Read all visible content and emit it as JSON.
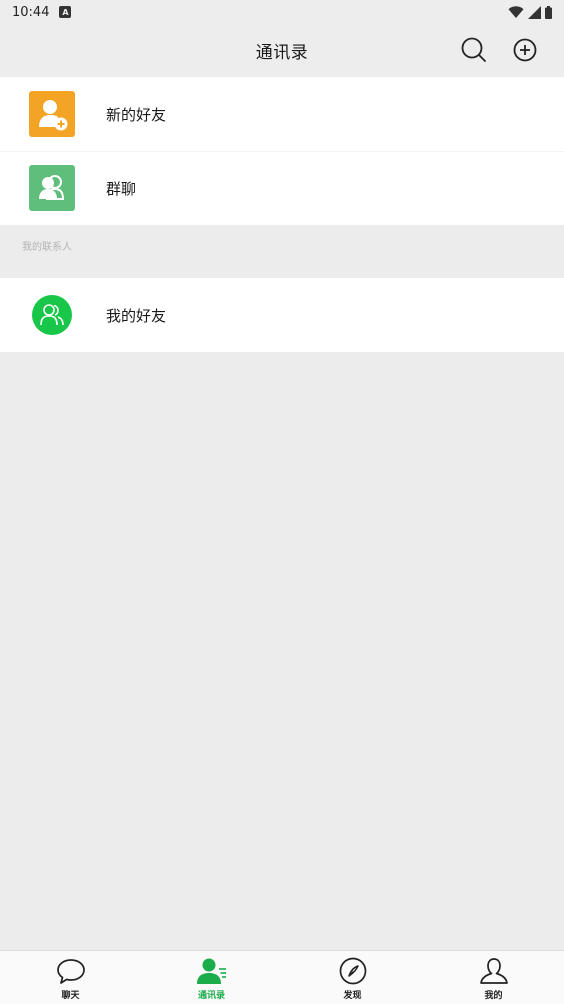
{
  "status_bar": {
    "time": "10:44",
    "indicator": "A"
  },
  "header": {
    "title": "通讯录"
  },
  "top_items": [
    {
      "label": "新的好友",
      "icon": "add-friend-icon",
      "color": "#f4a425"
    },
    {
      "label": "群聊",
      "icon": "group-chat-icon",
      "color": "#5fbe7c"
    }
  ],
  "section": {
    "title": "我的联系人"
  },
  "friends": [
    {
      "label": "我的好友",
      "icon": "friends-icon",
      "color": "#18c74a"
    }
  ],
  "tabs": [
    {
      "label": "聊天",
      "icon": "chat-bubble-icon",
      "active": false
    },
    {
      "label": "通讯录",
      "icon": "contacts-icon",
      "active": true
    },
    {
      "label": "发现",
      "icon": "compass-icon",
      "active": false
    },
    {
      "label": "我的",
      "icon": "person-icon",
      "active": false
    }
  ],
  "colors": {
    "accent": "#1aad4a",
    "background": "#ececec"
  }
}
